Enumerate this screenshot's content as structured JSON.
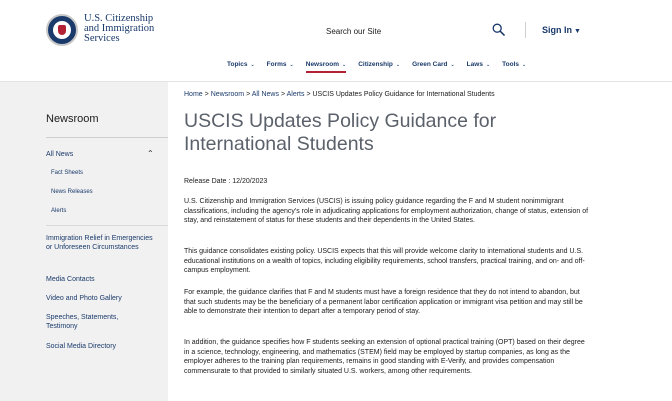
{
  "header": {
    "agency_lines": [
      "U.S. Citizenship",
      "and Immigration",
      "Services"
    ],
    "search_placeholder": "Search our Site",
    "signin_label": "Sign In",
    "nav": [
      {
        "label": "Topics"
      },
      {
        "label": "Forms"
      },
      {
        "label": "Newsroom",
        "active": true
      },
      {
        "label": "Citizenship"
      },
      {
        "label": "Green Card"
      },
      {
        "label": "Laws"
      },
      {
        "label": "Tools"
      }
    ]
  },
  "sidebar": {
    "title": "Newsroom",
    "all_news": "All News",
    "sub_items": [
      "Fact Sheets",
      "News Releases",
      "Alerts"
    ],
    "items": [
      "Immigration Relief in Emergencies or Unforeseen Circumstances",
      "Media Contacts",
      "Video and Photo Gallery",
      "Speeches, Statements, Testimony",
      "Social Media Directory"
    ]
  },
  "breadcrumb": {
    "home": "Home",
    "newsroom": "Newsroom",
    "all_news": "All News",
    "alerts": "Alerts",
    "current": "USCIS Updates Policy Guidance for International Students",
    "sep": ">"
  },
  "article": {
    "title": "USCIS Updates Policy Guidance for International Students",
    "release_date": "Release Date : 12/20/2023",
    "paragraphs": [
      "U.S. Citizenship and Immigration Services (USCIS) is issuing policy guidance regarding the F and M student nonimmigrant classifications, including the agency's role in adjudicating applications for employment authorization, change of status, extension of stay, and reinstatement of status for these students and their dependents in the United States.",
      "This guidance consolidates existing policy. USCIS expects that this will provide welcome clarity to international students and U.S. educational institutions on a wealth of topics, including eligibility requirements, school transfers, practical training, and on- and off-campus employment.",
      "For example, the guidance clarifies that F and M students must have a foreign residence that they do not intend to abandon, but that such students may be the beneficiary of a permanent labor certification application or immigrant visa petition and may still be able to demonstrate their intention to depart after a temporary period of stay.",
      "In addition, the guidance specifies how F students seeking an extension of optional practical training (OPT) based on their degree in a science, technology, engineering, and mathematics (STEM) field may be employed by startup companies, as long as the employer adheres to the training plan requirements, remains in good standing with E-Verify, and provides compensation commensurate to that provided to similarly situated U.S. workers, among other requirements."
    ]
  },
  "colors": {
    "brand_navy": "#1a3a6b",
    "accent_red": "#b22234",
    "title_gray": "#5b616b",
    "sidebar_bg": "#f1f1f1"
  }
}
